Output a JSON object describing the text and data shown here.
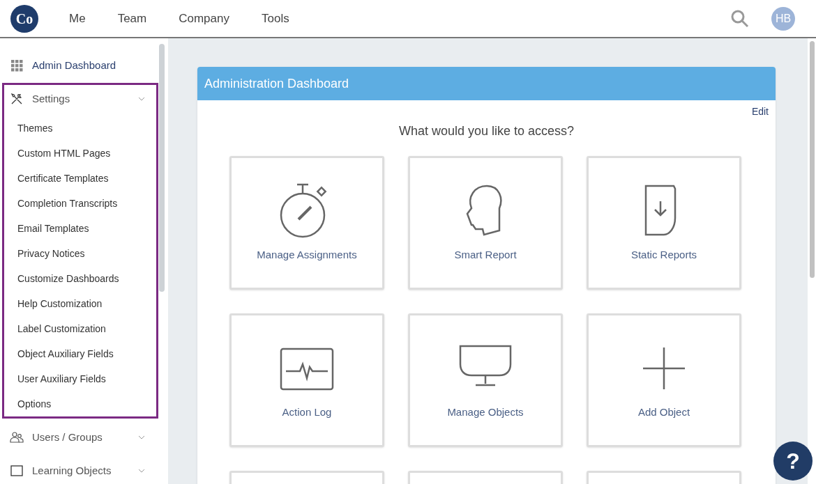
{
  "nav": {
    "logo": "Co",
    "items": [
      "Me",
      "Team",
      "Company",
      "Tools"
    ],
    "avatar": "HB"
  },
  "sidebar": {
    "items": [
      {
        "label": "Admin Dashboard",
        "kind": "grid",
        "highlighted": false
      },
      {
        "label": "Settings",
        "kind": "tools",
        "expanded": true,
        "highlighted": true,
        "children": [
          {
            "label": "Themes"
          },
          {
            "label": "Custom HTML Pages"
          },
          {
            "label": "Certificate Templates"
          },
          {
            "label": "Completion Transcripts"
          },
          {
            "label": "Email Templates"
          },
          {
            "label": "Privacy Notices"
          },
          {
            "label": "Customize Dashboards"
          },
          {
            "label": "Help Customization"
          },
          {
            "label": "Label Customization"
          },
          {
            "label": "Object Auxiliary Fields"
          },
          {
            "label": "User Auxiliary Fields"
          },
          {
            "label": "Options"
          }
        ]
      },
      {
        "label": "Users / Groups",
        "kind": "users",
        "highlighted": false
      },
      {
        "label": "Learning Objects",
        "kind": "square",
        "highlighted": false
      }
    ]
  },
  "panel": {
    "title": "Administration Dashboard",
    "edit": "Edit",
    "question": "What would you like to access?",
    "tiles": [
      {
        "label": "Manage Assignments",
        "kind": "stopwatch"
      },
      {
        "label": "Smart Report",
        "kind": "head"
      },
      {
        "label": "Static Reports",
        "kind": "download"
      },
      {
        "label": "Action Log",
        "kind": "pulse"
      },
      {
        "label": "Manage Objects",
        "kind": "monitor"
      },
      {
        "label": "Add Object",
        "kind": "plus"
      }
    ]
  },
  "help": "?"
}
